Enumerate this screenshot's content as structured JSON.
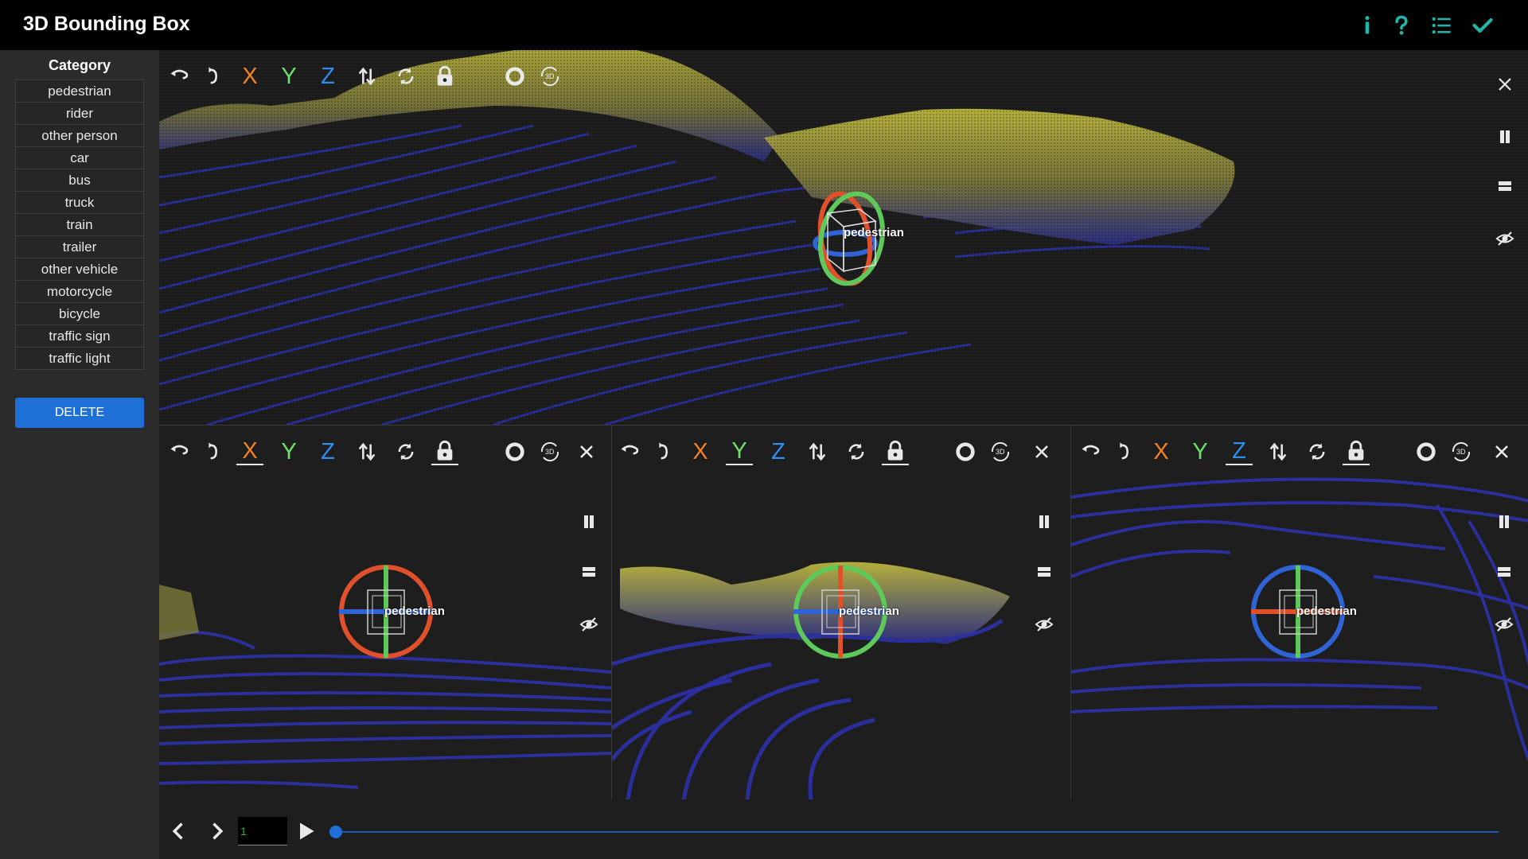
{
  "app": {
    "title": "3D Bounding Box"
  },
  "header": {
    "icons": {
      "info": "info-icon",
      "help": "help-icon",
      "list": "list-icon",
      "submit": "check-icon"
    },
    "accent": "#1fb5a8"
  },
  "sidebar": {
    "heading": "Category",
    "categories": [
      "pedestrian",
      "rider",
      "other person",
      "car",
      "bus",
      "truck",
      "train",
      "trailer",
      "other vehicle",
      "motorcycle",
      "bicycle",
      "traffic sign",
      "traffic light"
    ],
    "delete_label": "DELETE",
    "delete_color": "#1e6fd6"
  },
  "toolbar": {
    "x_label": "X",
    "y_label": "Y",
    "z_label": "Z",
    "threed_badge": "3D"
  },
  "views": {
    "main": {
      "label": "pedestrian"
    },
    "side_x": {
      "label": "pedestrian",
      "active_axis": "X"
    },
    "side_y": {
      "label": "pedestrian",
      "active_axis": "Y"
    },
    "side_z": {
      "label": "pedestrian",
      "active_axis": "Z"
    }
  },
  "colors": {
    "x_axis": "#f4821f",
    "y_axis": "#6ee06a",
    "z_axis": "#2f8ff0",
    "ground_points": "#2b2f9c",
    "high_points": "#b9b43a"
  },
  "playback": {
    "frame_value": "1"
  }
}
